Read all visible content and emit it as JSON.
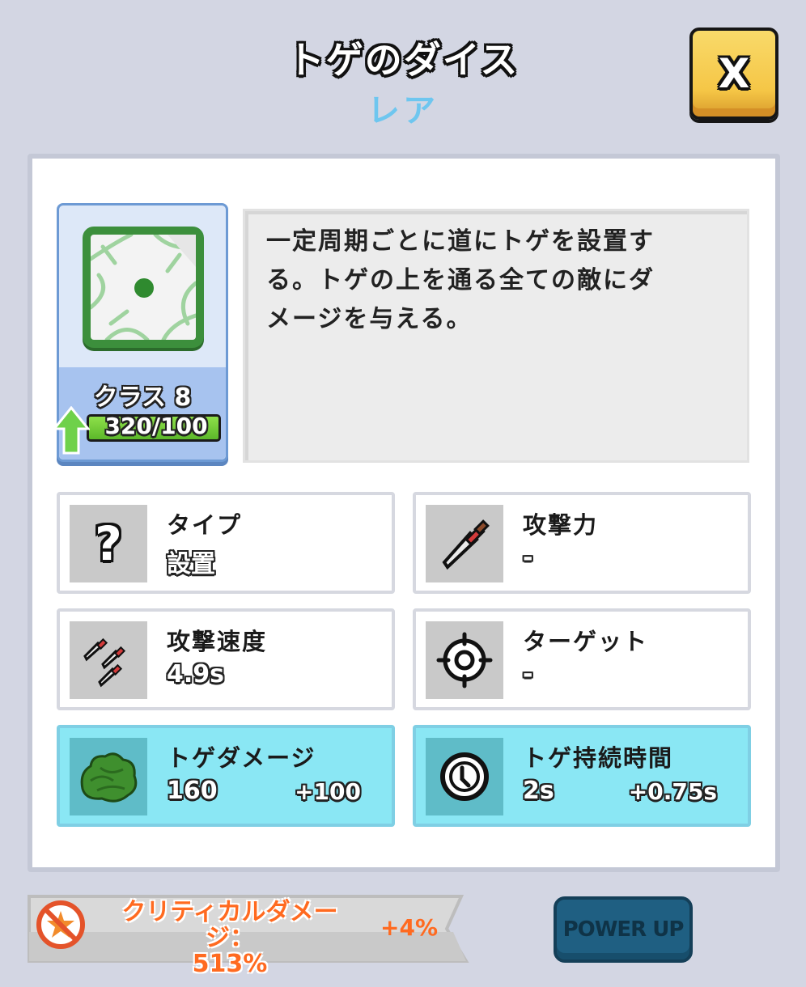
{
  "header": {
    "title": "トゲのダイス",
    "rarity": "レア",
    "close_label": "X"
  },
  "card": {
    "class_label": "クラス 8",
    "progress_text": "320/100",
    "progress_fraction": 1.0
  },
  "description": {
    "line1": "一定周期ごとに道にトゲを設置す",
    "line2": "る。トゲの上を通る全ての敵にダ",
    "line3": "メージを与える。"
  },
  "stats": {
    "type": {
      "label": "タイプ",
      "value": "設置",
      "icon": "question-icon"
    },
    "attack": {
      "label": "攻撃力",
      "value": "-",
      "icon": "sword-icon"
    },
    "speed": {
      "label": "攻撃速度",
      "value": "4.9s",
      "icon": "daggers-icon"
    },
    "target": {
      "label": "ターゲット",
      "value": "-",
      "icon": "crosshair-icon"
    },
    "thorn_damage": {
      "label": "トゲダメージ",
      "value": "160",
      "bonus": "+100",
      "icon": "thorn-bush-icon"
    },
    "thorn_duration": {
      "label": "トゲ持続時間",
      "value": "2s",
      "bonus": "+0.75s",
      "icon": "clock-icon"
    }
  },
  "footer": {
    "crit_label": "クリティカルダメージ：",
    "crit_value": "513%",
    "crit_bonus": "+4%",
    "power_up_label": "POWER UP"
  },
  "colors": {
    "background": "#d3d6e3",
    "rarity": "#6ec6ef",
    "close_button": "#f5c646",
    "highlight_stat": "#8ae7f4",
    "crit_text": "#ff6a20",
    "power_button": "#1f5f82"
  }
}
